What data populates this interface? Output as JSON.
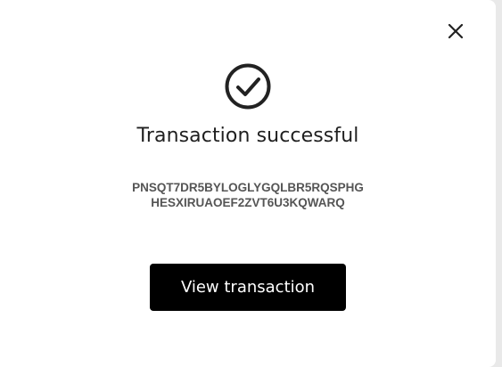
{
  "modal": {
    "title": "Transaction successful",
    "tx_hash_line1": "PNSQT7DR5BYLOGLYGQLBR5RQSPHG",
    "tx_hash_line2": "HESXIRUAOEF2ZVT6U3KQWARQ",
    "view_button_label": "View transaction",
    "close_icon": "close-icon",
    "status_icon": "check-circle-icon"
  },
  "colors": {
    "button_bg": "#000000",
    "button_text": "#ffffff",
    "title": "#1f1f1f",
    "hash_text": "#555555"
  }
}
